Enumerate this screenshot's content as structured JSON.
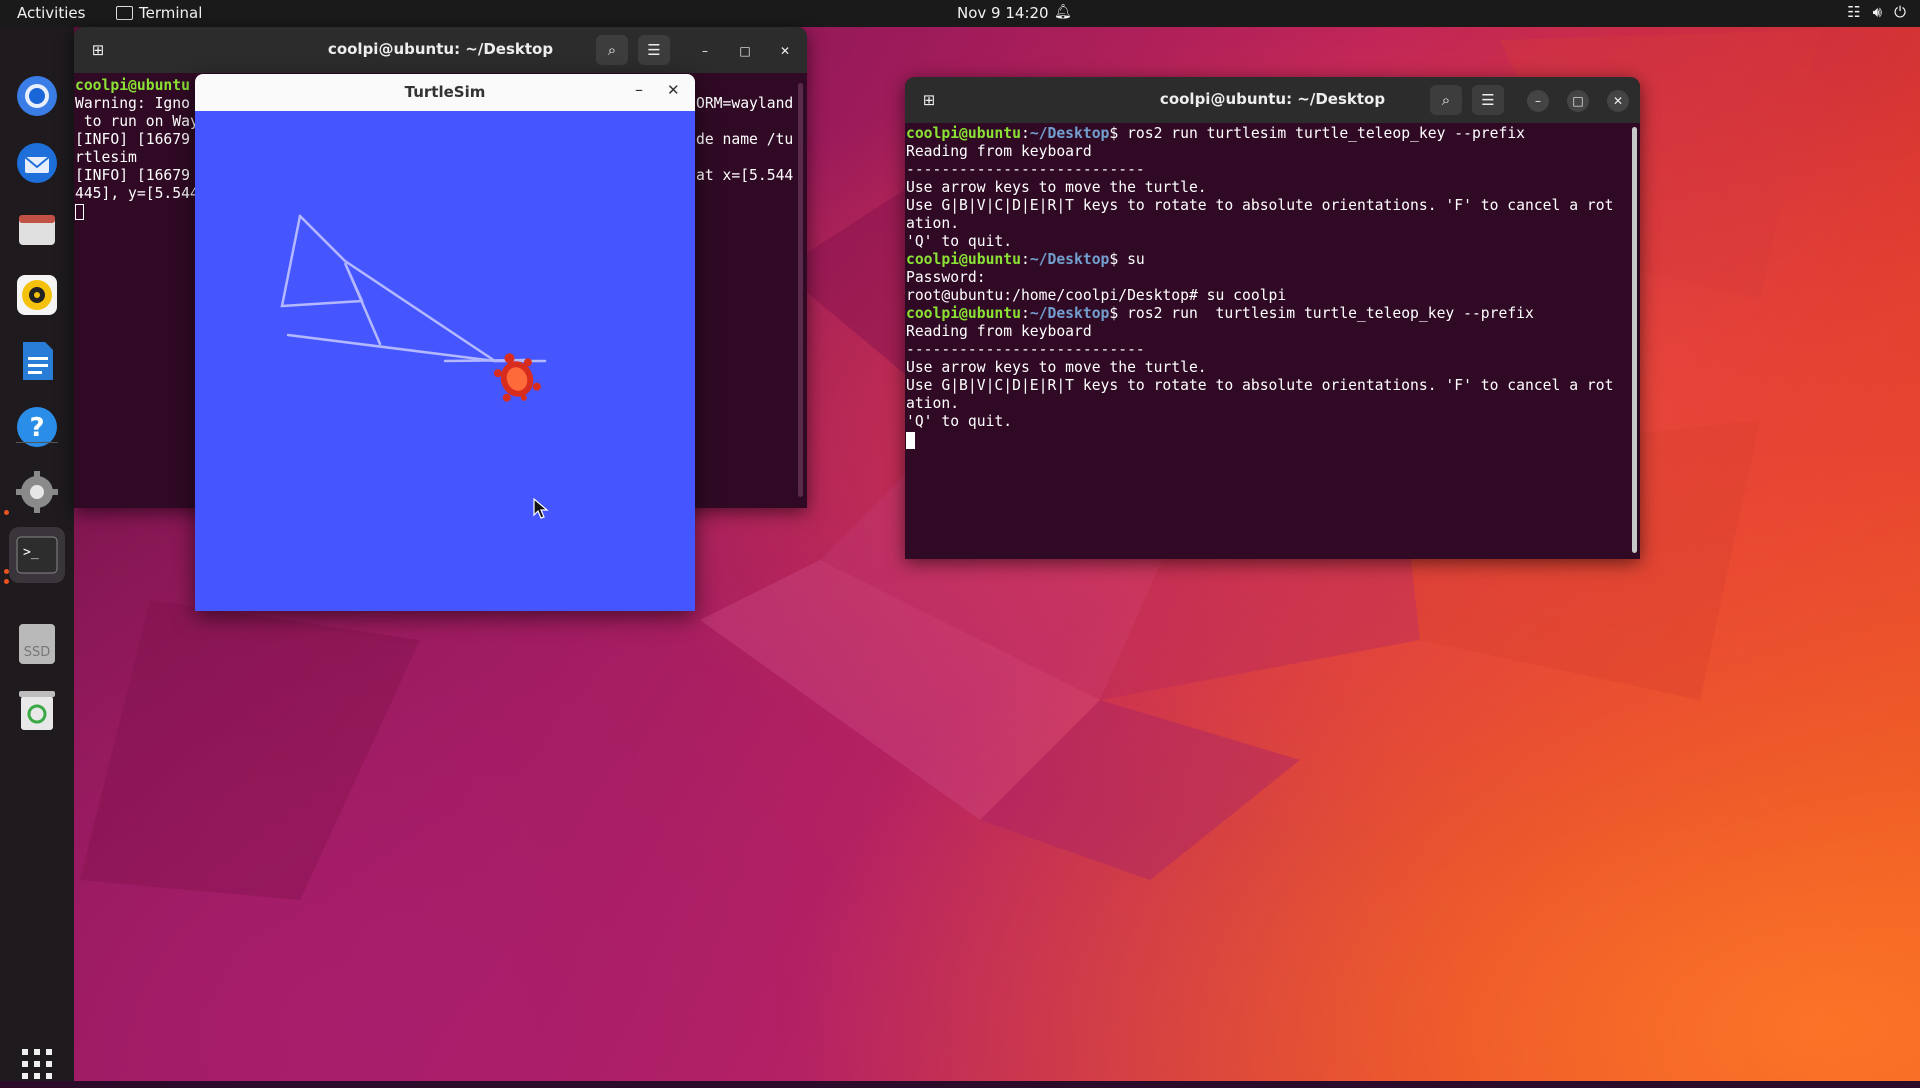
{
  "topbar": {
    "activities": "Activities",
    "app_name": "Terminal",
    "clock": "Nov 9  14:20"
  },
  "dock": {
    "items": [
      "chromium-icon",
      "thunderbird-icon",
      "files-icon",
      "rhythmbox-icon",
      "writer-icon",
      "help-icon",
      "settings-icon",
      "terminal-icon",
      "ssd-drive-icon",
      "trash-icon",
      "show-apps-icon"
    ],
    "ssd_label": "SSD"
  },
  "terminal_back": {
    "title": "coolpi@ubuntu: ~/Desktop",
    "left_lines": [
      "coolpi@ubuntu",
      "Warning: Igno",
      " to run on Way",
      "[INFO] [16679",
      "rtlesim",
      "[INFO] [16679",
      "445], y=[5.544"
    ],
    "right_lines": [
      "",
      "ORM=wayland",
      "",
      "de name /tu",
      "",
      "at x=[5.544"
    ]
  },
  "turtlesim": {
    "title": "TurtleSim",
    "background_color": "#4556ff",
    "pen_color": "#b3b8ff"
  },
  "terminal_front": {
    "title": "coolpi@ubuntu: ~/Desktop",
    "user": "coolpi@ubuntu",
    "path": "~/Desktop",
    "lines": {
      "l1_cmd": "$ ros2 run turtlesim turtle_teleop_key --prefix",
      "l2": "Reading from keyboard",
      "l3": "---------------------------",
      "l4": "Use arrow keys to move the turtle.",
      "l5": "Use G|B|V|C|D|E|R|T keys to rotate to absolute orientations. 'F' to cancel a rot",
      "l6": "ation.",
      "l7": "'Q' to quit.",
      "l8_cmd": "$ su",
      "l9": "Password:",
      "l10": "root@ubuntu:/home/coolpi/Desktop# su coolpi",
      "l11_cmd": "$ ros2 run  turtlesim turtle_teleop_key --prefix",
      "l12": "Reading from keyboard",
      "l13": "---------------------------",
      "l14": "Use arrow keys to move the turtle.",
      "l15": "Use G|B|V|C|D|E|R|T keys to rotate to absolute orientations. 'F' to cancel a rot",
      "l16": "ation.",
      "l17": "'Q' to quit."
    }
  },
  "colors": {
    "terminal_bg": "#300a24",
    "prompt_user": "#8ae234",
    "prompt_path": "#729fcf",
    "accent": "#e95420"
  }
}
